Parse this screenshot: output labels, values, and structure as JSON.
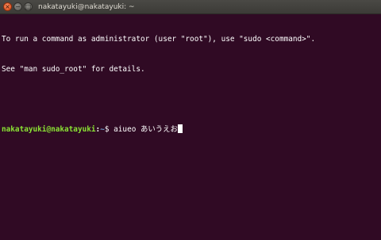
{
  "window": {
    "title": "nakatayuki@nakatayuki: ~",
    "controls": {
      "close_icon": "close-icon",
      "minimize_icon": "minimize-icon",
      "maximize_icon": "maximize-icon"
    }
  },
  "terminal": {
    "lines": [
      "To run a command as administrator (user \"root\"), use \"sudo <command>\".",
      "See \"man sudo_root\" for details."
    ],
    "prompt": {
      "user_host": "nakatayuki@nakatayuki",
      "separator": ":",
      "path": "~",
      "symbol": "$ "
    },
    "input_text": "aiueo あいうえお"
  },
  "colors": {
    "background": "#300a24",
    "prompt_user": "#8ae234",
    "prompt_path": "#729fcf",
    "text": "#ffffff"
  }
}
